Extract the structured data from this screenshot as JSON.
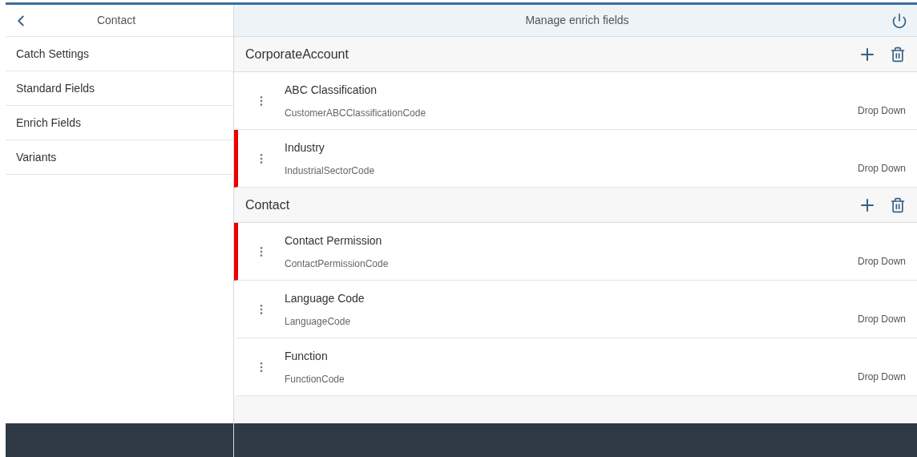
{
  "sidebar": {
    "title": "Contact",
    "items": [
      "Catch Settings",
      "Standard Fields",
      "Enrich Fields",
      "Variants"
    ]
  },
  "main": {
    "title": "Manage enrich fields",
    "sections": [
      {
        "title": "CorporateAccount",
        "fields": [
          {
            "label": "ABC Classification",
            "code": "CustomerABCClassificationCode",
            "type": "Drop Down",
            "marked": false
          },
          {
            "label": "Industry",
            "code": "IndustrialSectorCode",
            "type": "Drop Down",
            "marked": true
          }
        ]
      },
      {
        "title": "Contact",
        "fields": [
          {
            "label": "Contact Permission",
            "code": "ContactPermissionCode",
            "type": "Drop Down",
            "marked": true
          },
          {
            "label": "Language Code",
            "code": "LanguageCode",
            "type": "Drop Down",
            "marked": false
          },
          {
            "label": "Function",
            "code": "FunctionCode",
            "type": "Drop Down",
            "marked": false
          }
        ]
      }
    ]
  }
}
